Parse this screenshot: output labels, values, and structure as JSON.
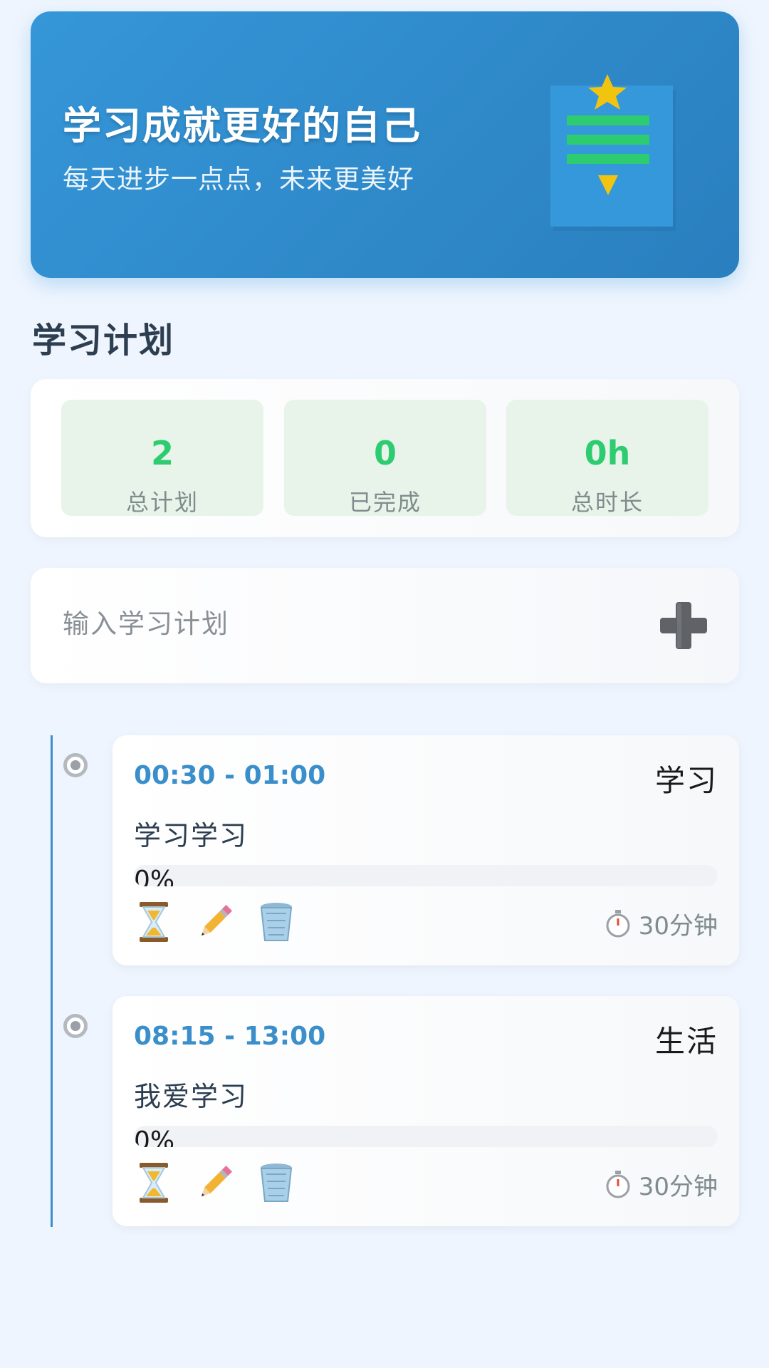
{
  "banner": {
    "title": "学习成就更好的自己",
    "subtitle": "每天进步一点点，未来更美好",
    "illustration_icon": "book-with-star-icon"
  },
  "section": {
    "title": "学习计划"
  },
  "stats": [
    {
      "value": "2",
      "label": "总计划"
    },
    {
      "value": "0",
      "label": "已完成"
    },
    {
      "value": "0h",
      "label": "总时长"
    }
  ],
  "input": {
    "placeholder": "输入学习计划",
    "value": "",
    "add_icon": "plus-icon"
  },
  "plans": [
    {
      "time": "00:30 - 01:00",
      "category": "学习",
      "name": "学习学习",
      "progress_label": "0%",
      "progress": 0,
      "duration": "30分钟",
      "actions": [
        "hourglass-icon",
        "pencil-icon",
        "trash-icon"
      ]
    },
    {
      "time": "08:15 - 13:00",
      "category": "生活",
      "name": "我爱学习",
      "progress_label": "0%",
      "progress": 0,
      "duration": "30分钟",
      "actions": [
        "hourglass-icon",
        "pencil-icon",
        "trash-icon"
      ]
    }
  ],
  "colors": {
    "background": "#eff5fe",
    "banner": "#3596d8",
    "accent": "#3a8fcb",
    "stat_value": "#2ecc71",
    "stat_bg": "#e8f4ea"
  }
}
